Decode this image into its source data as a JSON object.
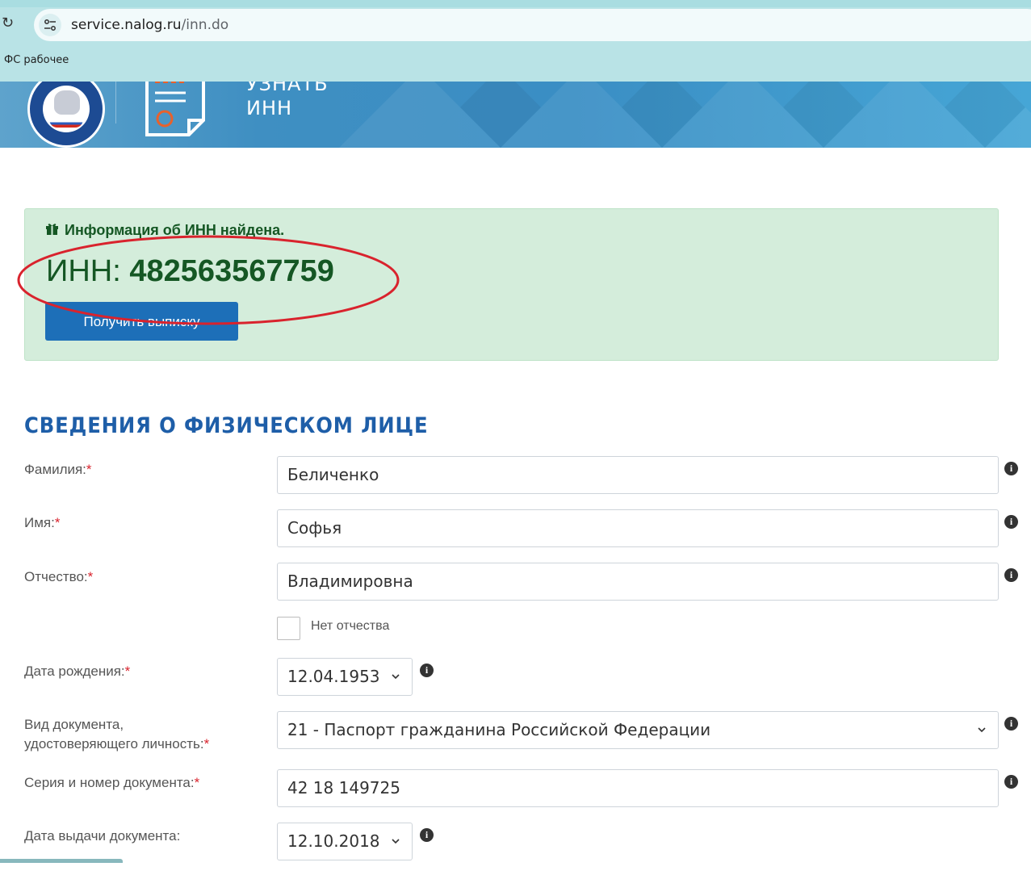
{
  "browser": {
    "url_host": "service.nalog.ru",
    "url_path": "/inn.do",
    "bookmark": "ФС рабочее"
  },
  "header": {
    "title_line1": "УЗНАТЬ",
    "title_line2": "ИНН"
  },
  "result": {
    "heading": "Информация об ИНН найдена.",
    "inn_label": "ИНН:",
    "inn_value": "482563567759",
    "button": "Получить выписку"
  },
  "section": {
    "title": "СВЕДЕНИЯ О ФИЗИЧЕСКОМ ЛИЦЕ"
  },
  "form": {
    "surname": {
      "label": "Фамилия:",
      "value": "Беличенко"
    },
    "name": {
      "label": "Имя:",
      "value": "Софья"
    },
    "patronymic": {
      "label": "Отчество:",
      "value": "Владимировна"
    },
    "no_patronymic": {
      "label": "Нет отчества",
      "checked": false
    },
    "birth_date": {
      "label": "Дата рождения:",
      "value": "12.04.1953"
    },
    "doc_type": {
      "label_line1": "Вид документа,",
      "label_line2": "удостоверяющего личность:",
      "value": "21 - Паспорт гражданина Российской Федерации"
    },
    "doc_number": {
      "label": "Серия и номер документа:",
      "value": "42 18 149725"
    },
    "issue_date": {
      "label": "Дата выдачи документа:",
      "value": "12.10.2018"
    },
    "required_mark": "*"
  },
  "colors": {
    "success_bg": "#d4eddb",
    "success_text": "#155724",
    "primary_button": "#1d6fb8",
    "section_title": "#1e5ea8",
    "annotation_oval": "#d9232d"
  }
}
